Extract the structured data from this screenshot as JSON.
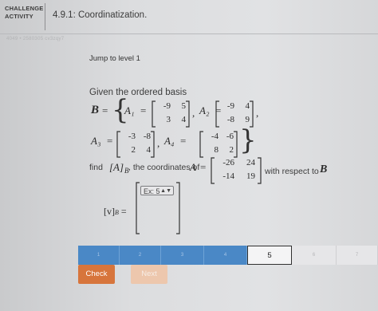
{
  "header": {
    "badge_line1": "CHALLENGE",
    "badge_line2": "ACTIVITY",
    "title": "4.9.1: Coordinatization."
  },
  "subheader": {
    "text": "4049 • 2580305 cv3zqy7"
  },
  "jump_label": "Jump to level 1",
  "problem": {
    "given_text": "Given the ordered basis",
    "basis_symbol": "B",
    "eq": "=",
    "A1_name": "A₁",
    "A1": [
      [
        "-9",
        "5"
      ],
      [
        "3",
        "4"
      ]
    ],
    "A2_name": "A₂",
    "A2": [
      [
        "-9",
        "4"
      ],
      [
        "-8",
        "9"
      ]
    ],
    "A3_name": "A₃",
    "A3": [
      [
        "-3",
        "-8"
      ],
      [
        "2",
        "4"
      ]
    ],
    "A4_name": "A₄",
    "A4": [
      [
        "-4",
        "-6"
      ],
      [
        "8",
        "2"
      ]
    ],
    "find_text": "find",
    "find_bracket": "[A]",
    "find_sub": "B",
    "find_text2": ", the coordinates of",
    "A_name": "A",
    "A": [
      [
        "-26",
        "24"
      ],
      [
        "-14",
        "19"
      ]
    ],
    "respect_text": "with respect to",
    "answer_label": "[v]",
    "answer_sub": "B",
    "answer_select": {
      "value": "Ex: 5"
    }
  },
  "progress": {
    "segments": [
      "1",
      "2",
      "3",
      "4",
      "5",
      "6",
      "7"
    ],
    "current": 5,
    "completed": 4
  },
  "buttons": {
    "check": "Check",
    "next": "Next"
  },
  "colors": {
    "accent": "#d7753c",
    "progress_done": "#4a88c6"
  }
}
